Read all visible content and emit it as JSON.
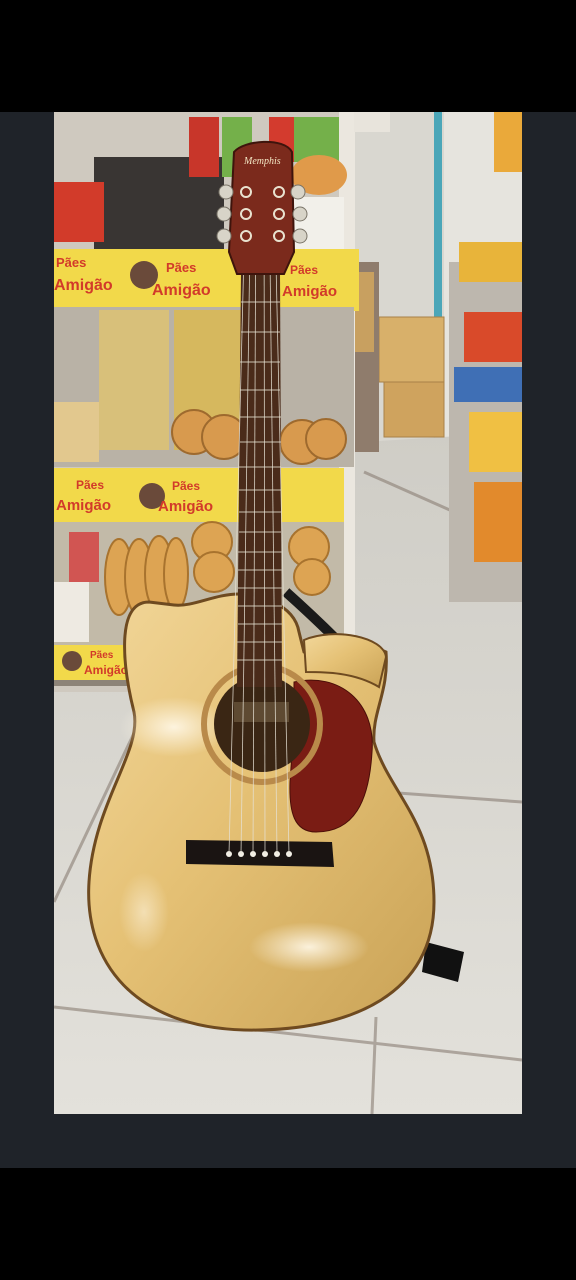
{
  "photo": {
    "subject_icon": "acoustic-guitar",
    "shelf_signs": [
      {
        "line1": "Pães",
        "line2": "Amigão"
      },
      {
        "line1": "Pães",
        "line2": "Amigão"
      },
      {
        "line1": "Pães",
        "line2": "Amigão"
      },
      {
        "line1": "Pães",
        "line2": "Amigão"
      },
      {
        "line1": "Pães",
        "line2": "Amigão"
      },
      {
        "line1": "Pães",
        "line2": "Amigão"
      }
    ],
    "headstock_logo": "Memphis",
    "colors": {
      "frame": "#1f2329",
      "guitar_top": "#e9c97e",
      "pickguard": "#7a1c14",
      "shelf_sign": "#f2d94a",
      "floor": "#d7d4cd"
    }
  }
}
